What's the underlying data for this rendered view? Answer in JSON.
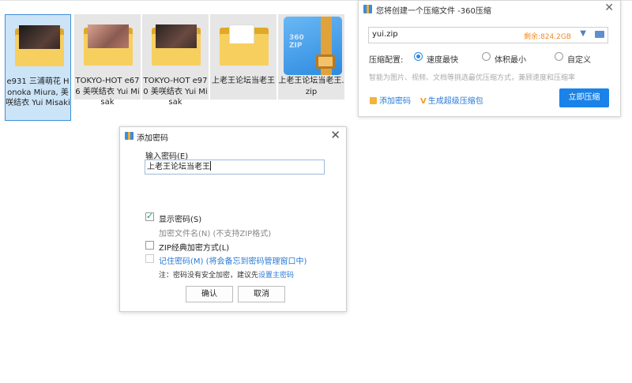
{
  "files": [
    {
      "name": "e931 三浦萌花 Honoka Miura, 美咲结衣 Yui Misaki",
      "type": "folder-with-photo",
      "selected": true
    },
    {
      "name": "TOKYO-HOT e676 美咲结衣 Yui Misak",
      "type": "folder-with-photo",
      "selected": false
    },
    {
      "name": "TOKYO-HOT e970 美咲结衣 Yui Misak",
      "type": "folder-with-photo",
      "selected": false
    },
    {
      "name": "上老王论坛当老王",
      "type": "folder-with-doc",
      "selected": false
    },
    {
      "name": "上老王论坛当老王.zip",
      "type": "zip-archive",
      "selected": false
    }
  ],
  "zip_icon_text": {
    "line1": "360",
    "line2": "ZIP"
  },
  "compress_panel": {
    "title": "您将创建一个压缩文件 -360压缩",
    "close_label": "✕",
    "filename": "yui.zip",
    "free_space": "剩余:824.2GB",
    "level_label": "压缩配置:",
    "options": [
      {
        "label": "速度最快",
        "selected": true
      },
      {
        "label": "体积最小",
        "selected": false
      },
      {
        "label": "自定义",
        "selected": false
      }
    ],
    "hint": "智能为图片、视频、文档等挑选最优压缩方式，兼顾速度和压缩率",
    "add_password": "添加密码",
    "super_package": "生成超级压缩包",
    "compress_button": "立即压缩",
    "accent": "#1a82e8"
  },
  "password_dialog": {
    "title": "添加密码",
    "close_label": "✕",
    "input_label": "输入密码(E)",
    "password_value": "上老王论坛当老王",
    "show_password": {
      "label": "显示密码(S)",
      "checked": true
    },
    "encrypt_filenames": {
      "label": "加密文件名(N) (不支持ZIP格式)",
      "checked": false,
      "disabled": true
    },
    "zip_classic": {
      "label": "ZIP经典加密方式(L)",
      "checked": false
    },
    "remember": {
      "label": "记住密码(M) (将会备忘到密码管理窗口中)",
      "checked": false
    },
    "note_prefix": "注：密码没有安全加密，建议先",
    "note_link": "设置主密码",
    "ok_label": "确认",
    "cancel_label": "取消"
  }
}
